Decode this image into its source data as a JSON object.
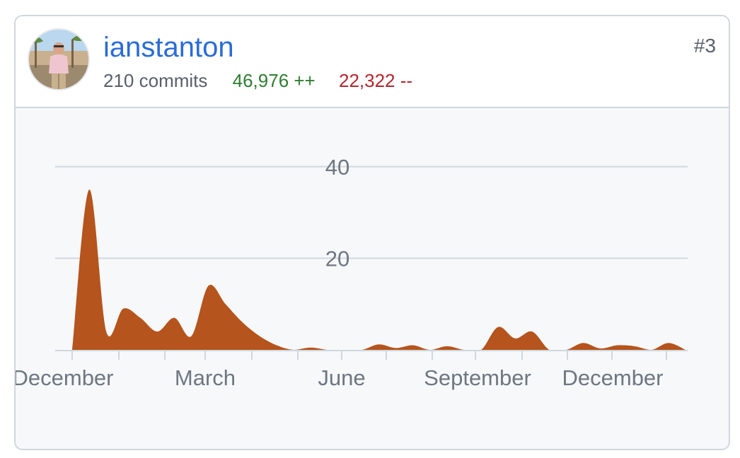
{
  "contributor": {
    "username": "ianstanton",
    "commits_text": "210 commits",
    "additions_text": "46,976 ++",
    "deletions_text": "22,322 --",
    "rank": "#3",
    "avatar_icon": "user-avatar-photo"
  },
  "colors": {
    "area": "#b5541c",
    "additions": "#2f7d32",
    "deletions": "#b3262d",
    "link": "#2a6cd6"
  },
  "chart_data": {
    "type": "area",
    "title": "",
    "xlabel": "",
    "ylabel": "",
    "ylim": [
      0,
      50
    ],
    "y_ticks": [
      20,
      40
    ],
    "grid": true,
    "x_tick_labels": [
      "December",
      "March",
      "June",
      "September",
      "December"
    ],
    "series": [
      {
        "values": [
          0,
          35,
          4,
          9,
          7,
          4,
          7,
          3,
          14,
          10,
          6,
          3,
          1,
          0,
          0.5,
          0,
          0,
          0,
          1.2,
          0.4,
          1,
          0,
          0.8,
          0,
          0,
          5,
          2.5,
          4,
          0,
          0,
          1.5,
          0.3,
          1,
          0.8,
          0,
          1.5,
          0
        ]
      }
    ]
  }
}
